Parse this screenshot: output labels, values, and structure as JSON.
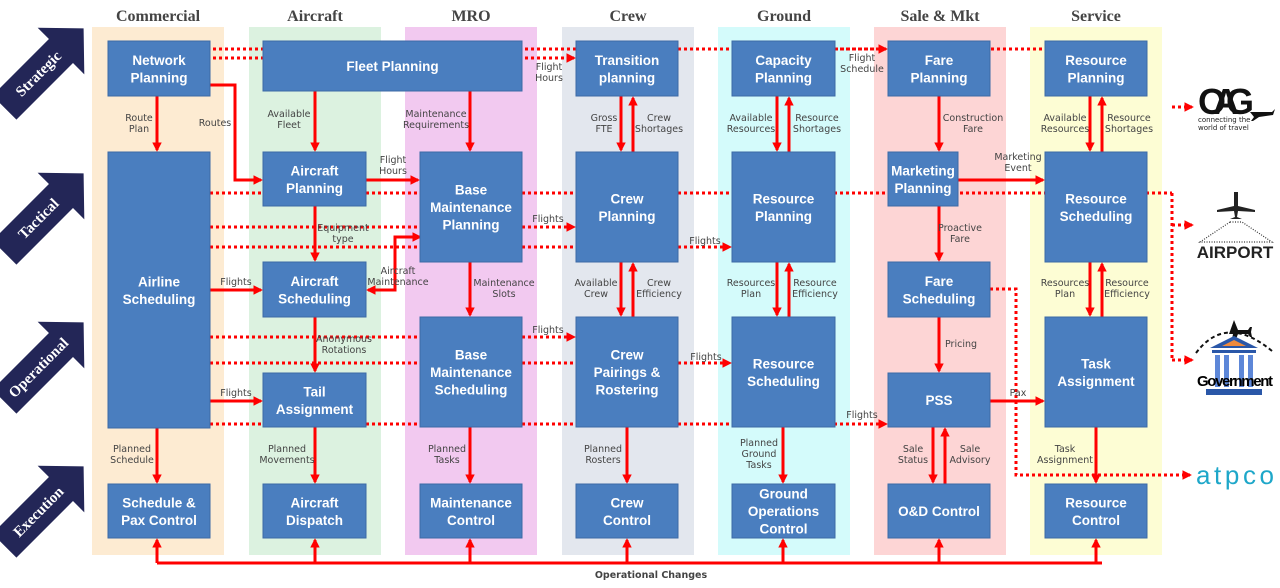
{
  "colors": {
    "box": "#4a7ebf",
    "arrow": "#ff0000",
    "level_arrow": "#232657",
    "bands": [
      "#fdebd2",
      "#dcf2e0",
      "#f2c9f0",
      "#e3e7ee",
      "#d4fbfb",
      "#fdd5d5",
      "#fdfdd4"
    ]
  },
  "columns": [
    "Commercial",
    "Aircraft",
    "MRO",
    "Crew",
    "Ground",
    "Sale & Mkt",
    "Service"
  ],
  "levels": [
    "Strategic",
    "Tactical",
    "Operational",
    "Execution"
  ],
  "boxes": [
    {
      "id": "network-planning",
      "lines": [
        "Network",
        "Planning"
      ]
    },
    {
      "id": "fleet-planning",
      "lines": [
        "Fleet Planning"
      ]
    },
    {
      "id": "transition-planning",
      "lines": [
        "Transition",
        "planning"
      ]
    },
    {
      "id": "capacity-planning",
      "lines": [
        "Capacity",
        "Planning"
      ]
    },
    {
      "id": "fare-planning",
      "lines": [
        "Fare",
        "Planning"
      ]
    },
    {
      "id": "service-resource-planning",
      "lines": [
        "Resource",
        "Planning"
      ]
    },
    {
      "id": "airline-scheduling",
      "lines": [
        "Airline",
        "Scheduling"
      ]
    },
    {
      "id": "aircraft-planning",
      "lines": [
        "Aircraft",
        "Planning"
      ]
    },
    {
      "id": "base-maintenance-planning",
      "lines": [
        "Base",
        "Maintenance",
        "Planning"
      ]
    },
    {
      "id": "crew-planning",
      "lines": [
        "Crew",
        "Planning"
      ]
    },
    {
      "id": "ground-resource-planning",
      "lines": [
        "Resource",
        "Planning"
      ]
    },
    {
      "id": "marketing-planning",
      "lines": [
        "Marketing",
        "Planning"
      ]
    },
    {
      "id": "service-resource-scheduling",
      "lines": [
        "Resource",
        "Scheduling"
      ]
    },
    {
      "id": "aircraft-scheduling",
      "lines": [
        "Aircraft",
        "Scheduling"
      ]
    },
    {
      "id": "fare-scheduling",
      "lines": [
        "Fare",
        "Scheduling"
      ]
    },
    {
      "id": "base-maintenance-scheduling",
      "lines": [
        "Base",
        "Maintenance",
        "Scheduling"
      ]
    },
    {
      "id": "crew-pairings-rostering",
      "lines": [
        "Crew",
        "Pairings &",
        "Rostering"
      ]
    },
    {
      "id": "ground-resource-scheduling",
      "lines": [
        "Resource",
        "Scheduling"
      ]
    },
    {
      "id": "task-assignment",
      "lines": [
        "Task",
        "Assignment"
      ]
    },
    {
      "id": "tail-assignment",
      "lines": [
        "Tail",
        "Assignment"
      ]
    },
    {
      "id": "pss",
      "lines": [
        "PSS"
      ]
    },
    {
      "id": "schedule-pax-control",
      "lines": [
        "Schedule &",
        "Pax Control"
      ]
    },
    {
      "id": "aircraft-dispatch",
      "lines": [
        "Aircraft",
        "Dispatch"
      ]
    },
    {
      "id": "maintenance-control",
      "lines": [
        "Maintenance",
        "Control"
      ]
    },
    {
      "id": "crew-control",
      "lines": [
        "Crew",
        "Control"
      ]
    },
    {
      "id": "ground-operations-control",
      "lines": [
        "Ground",
        "Operations",
        "Control"
      ]
    },
    {
      "id": "od-control",
      "lines": [
        "O&D Control"
      ]
    },
    {
      "id": "resource-control",
      "lines": [
        "Resource",
        "Control"
      ]
    }
  ],
  "flow_labels": [
    [
      "Route",
      "Plan"
    ],
    [
      "Routes"
    ],
    [
      "Available",
      "Fleet"
    ],
    [
      "Maintenance",
      "Requirements"
    ],
    [
      "Flight",
      "Hours"
    ],
    [
      "Flight",
      "Hours"
    ],
    [
      "Gross",
      "FTE"
    ],
    [
      "Crew",
      "Shortages"
    ],
    [
      "Available",
      "Resources"
    ],
    [
      "Resource",
      "Shortages"
    ],
    [
      "Flight",
      "Schedule"
    ],
    [
      "Construction",
      "Fare"
    ],
    [
      "Available",
      "Resources"
    ],
    [
      "Resource",
      "Shortages"
    ],
    [
      "Marketing",
      "Event"
    ],
    [
      "Equipment",
      "type"
    ],
    [
      "Flights"
    ],
    [
      "Flights"
    ],
    [
      "Proactive",
      "Fare"
    ],
    [
      "Flights"
    ],
    [
      "Aircraft",
      "Maintenance"
    ],
    [
      "Maintenance",
      "Slots"
    ],
    [
      "Available",
      "Crew"
    ],
    [
      "Crew",
      "Efficiency"
    ],
    [
      "Resources",
      "Plan"
    ],
    [
      "Resource",
      "Efficiency"
    ],
    [
      "Resources",
      "Plan"
    ],
    [
      "Resource",
      "Efficiency"
    ],
    [
      "Anonymous",
      "Rotations"
    ],
    [
      "Flights"
    ],
    [
      "Flights"
    ],
    [
      "Pricing"
    ],
    [
      "Flights"
    ],
    [
      "Flights"
    ],
    [
      "Pax"
    ],
    [
      "Planned",
      "Schedule"
    ],
    [
      "Planned",
      "Movements"
    ],
    [
      "Planned",
      "Tasks"
    ],
    [
      "Planned",
      "Rosters"
    ],
    [
      "Planned",
      "Ground",
      "Tasks"
    ],
    [
      "Sale",
      "Status"
    ],
    [
      "Sale",
      "Advisory"
    ],
    [
      "Task",
      "Assignment"
    ],
    [
      "Operational Changes"
    ]
  ],
  "external": {
    "oag": {
      "name": "OAG",
      "tagline": [
        "connecting the",
        "world of travel"
      ]
    },
    "airport": {
      "name": "AIRPORT"
    },
    "government": {
      "name": "Government"
    },
    "atpco": {
      "name": "atpco",
      "color": "#1ea7c9"
    }
  }
}
